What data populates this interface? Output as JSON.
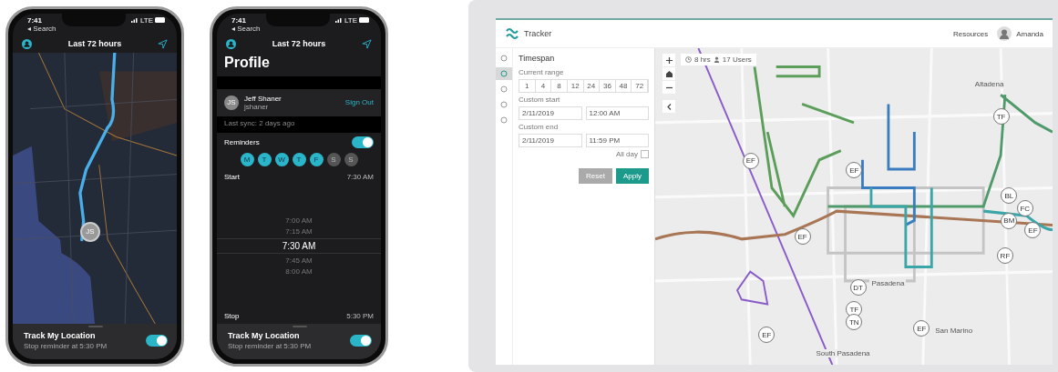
{
  "phones": [
    {
      "kind": "map",
      "status": {
        "time": "7:41",
        "back": "◂ Search",
        "network": "LTE"
      },
      "header": "Last 72 hours",
      "user_marker": "JS",
      "track": {
        "title": "Track My Location",
        "subtitle": "Stop reminder at 5:30 PM",
        "on": true
      }
    },
    {
      "kind": "profile",
      "status": {
        "time": "7:41",
        "back": "◂ Search",
        "network": "LTE"
      },
      "header": "Last 72 hours",
      "title": "Profile",
      "user": {
        "initials": "JS",
        "name": "Jeff Shaner",
        "username": "jshaner"
      },
      "sign_out": "Sign Out",
      "last_sync": "Last sync:  2 days ago",
      "reminders": {
        "label": "Reminders",
        "on": true
      },
      "days": [
        {
          "label": "M",
          "selected": true
        },
        {
          "label": "T",
          "selected": true
        },
        {
          "label": "W",
          "selected": true
        },
        {
          "label": "T",
          "selected": true
        },
        {
          "label": "F",
          "selected": true
        },
        {
          "label": "S",
          "selected": false
        },
        {
          "label": "S",
          "selected": false
        }
      ],
      "start": {
        "label": "Start",
        "value": "7:30 AM"
      },
      "picker": [
        {
          "label": "7:00 AM",
          "selected": false
        },
        {
          "label": "7:15 AM",
          "selected": false
        },
        {
          "label": "7:30 AM",
          "selected": true
        },
        {
          "label": "7:45 AM",
          "selected": false
        },
        {
          "label": "8:00 AM",
          "selected": false
        }
      ],
      "stop": {
        "label": "Stop",
        "value": "5:30 PM"
      },
      "track": {
        "title": "Track My Location",
        "subtitle": "Stop reminder at 5:30 PM",
        "on": true
      }
    }
  ],
  "laptop": {
    "app_name": "Tracker",
    "nav": {
      "link": "Resources",
      "user": "Amanda"
    },
    "tools": [
      {
        "selected": false
      },
      {
        "selected": true
      },
      {
        "selected": false
      },
      {
        "selected": false
      },
      {
        "selected": false
      }
    ],
    "panel": {
      "title": "Timespan",
      "range_label": "Current range",
      "ranges": [
        "1",
        "4",
        "8",
        "12",
        "24",
        "36",
        "48",
        "72"
      ],
      "start_label": "Custom start",
      "start_date": "2/11/2019",
      "start_time": "12:00 AM",
      "end_label": "Custom end",
      "end_date": "2/11/2019",
      "end_time": "11:59 PM",
      "all_day": {
        "label": "All day",
        "checked": false
      },
      "buttons": [
        "Reset",
        "Apply"
      ]
    },
    "chips": {
      "hours": "8 hrs",
      "users": "17 Users"
    },
    "places": [
      "Altadena",
      "Pasadena",
      "San Marino",
      "South Pasadena"
    ],
    "markers": [
      {
        "label": "TF"
      },
      {
        "label": "EF"
      },
      {
        "label": "EF"
      },
      {
        "label": "BL"
      },
      {
        "label": "FC"
      },
      {
        "label": "BM"
      },
      {
        "label": "EF"
      },
      {
        "label": "EF"
      },
      {
        "label": "RF"
      },
      {
        "label": "DT"
      },
      {
        "label": "TF"
      },
      {
        "label": "TN"
      },
      {
        "label": "EF"
      },
      {
        "label": "EF"
      }
    ]
  }
}
